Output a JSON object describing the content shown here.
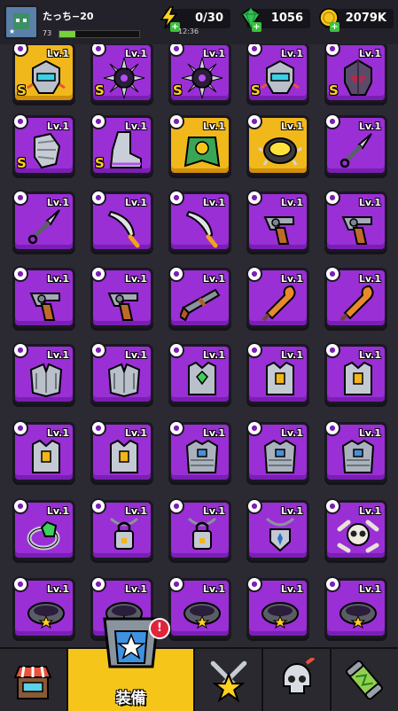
{
  "player": {
    "name": "たっち−20",
    "level": "73",
    "xp_progress": 0.2
  },
  "resources": {
    "energy": {
      "value": "0/30",
      "timer": "12:36",
      "icon": "lightning-icon"
    },
    "gems": {
      "value": "1056",
      "icon": "green-gem-icon"
    },
    "coins": {
      "value": "2079K",
      "icon": "gold-coin-icon"
    }
  },
  "level_label": "Lv.1",
  "grade_label": "S",
  "items": [
    {
      "name": "gold-mech-helmet",
      "icon": "helmet",
      "rarity": "gold",
      "s": true
    },
    {
      "name": "purple-spiked-helmet",
      "icon": "spike",
      "rarity": "purple",
      "s": true
    },
    {
      "name": "purple-spiked-helmet",
      "icon": "spike",
      "rarity": "purple",
      "s": true
    },
    {
      "name": "purple-mech-helmet",
      "icon": "helmet",
      "rarity": "purple",
      "s": true
    },
    {
      "name": "purple-dark-helmet",
      "icon": "darkhelm",
      "rarity": "purple",
      "s": true
    },
    {
      "name": "steel-gauntlet",
      "icon": "glove",
      "rarity": "purple",
      "s": true
    },
    {
      "name": "steel-boot",
      "icon": "boot",
      "rarity": "purple",
      "s": true
    },
    {
      "name": "green-cape",
      "icon": "cape",
      "rarity": "gold",
      "s": false
    },
    {
      "name": "gold-spiked-ring",
      "icon": "ring",
      "rarity": "gold",
      "s": false
    },
    {
      "name": "kunai",
      "icon": "kunai",
      "rarity": "purple",
      "s": false
    },
    {
      "name": "kunai",
      "icon": "kunai",
      "rarity": "purple",
      "s": false
    },
    {
      "name": "machete",
      "icon": "blade",
      "rarity": "purple",
      "s": false
    },
    {
      "name": "machete",
      "icon": "blade",
      "rarity": "purple",
      "s": false
    },
    {
      "name": "revolver",
      "icon": "gun",
      "rarity": "purple",
      "s": false
    },
    {
      "name": "revolver",
      "icon": "gun",
      "rarity": "purple",
      "s": false
    },
    {
      "name": "revolver",
      "icon": "gun",
      "rarity": "purple",
      "s": false
    },
    {
      "name": "revolver",
      "icon": "gun",
      "rarity": "purple",
      "s": false
    },
    {
      "name": "shotgun",
      "icon": "shotgun",
      "rarity": "purple",
      "s": false
    },
    {
      "name": "wooden-club",
      "icon": "club",
      "rarity": "purple",
      "s": false
    },
    {
      "name": "wooden-club",
      "icon": "club",
      "rarity": "purple",
      "s": false
    },
    {
      "name": "steel-shoulder-armor",
      "icon": "shoulder",
      "rarity": "purple",
      "s": false
    },
    {
      "name": "steel-shoulder-armor",
      "icon": "shoulder",
      "rarity": "purple",
      "s": false
    },
    {
      "name": "green-gem-vest",
      "icon": "vestgem",
      "rarity": "purple",
      "s": false
    },
    {
      "name": "steel-vest",
      "icon": "vest",
      "rarity": "purple",
      "s": false
    },
    {
      "name": "steel-vest",
      "icon": "vest",
      "rarity": "purple",
      "s": false
    },
    {
      "name": "steel-vest",
      "icon": "vest",
      "rarity": "purple",
      "s": false
    },
    {
      "name": "steel-vest",
      "icon": "vest",
      "rarity": "purple",
      "s": false
    },
    {
      "name": "blue-plate-armor",
      "icon": "plate",
      "rarity": "purple",
      "s": false
    },
    {
      "name": "blue-plate-armor",
      "icon": "plate",
      "rarity": "purple",
      "s": false
    },
    {
      "name": "blue-plate-armor",
      "icon": "plate",
      "rarity": "purple",
      "s": false
    },
    {
      "name": "emerald-ring",
      "icon": "emerald",
      "rarity": "purple",
      "s": false
    },
    {
      "name": "lock-necklace",
      "icon": "lock",
      "rarity": "purple",
      "s": false
    },
    {
      "name": "lock-necklace",
      "icon": "lock",
      "rarity": "purple",
      "s": false
    },
    {
      "name": "shield-amulet",
      "icon": "amulet",
      "rarity": "purple",
      "s": false
    },
    {
      "name": "skull-emblem",
      "icon": "skull",
      "rarity": "purple",
      "s": false
    },
    {
      "name": "star-belt",
      "icon": "belt",
      "rarity": "purple",
      "s": false
    },
    {
      "name": "star-belt",
      "icon": "belt",
      "rarity": "purple",
      "s": false
    },
    {
      "name": "star-belt",
      "icon": "belt",
      "rarity": "purple",
      "s": false
    },
    {
      "name": "star-belt",
      "icon": "belt",
      "rarity": "purple",
      "s": false
    },
    {
      "name": "star-belt",
      "icon": "belt",
      "rarity": "purple",
      "s": false
    }
  ],
  "nav": {
    "items": [
      {
        "name": "nav-shop",
        "icon": "shop-icon"
      },
      {
        "name": "nav-equipment",
        "icon": "equipment-icon",
        "label": "装備",
        "active": true,
        "badge": "!"
      },
      {
        "name": "nav-battle",
        "icon": "swords-star-icon"
      },
      {
        "name": "nav-boss",
        "icon": "skull-icon"
      },
      {
        "name": "nav-lab",
        "icon": "capsule-icon"
      }
    ]
  }
}
